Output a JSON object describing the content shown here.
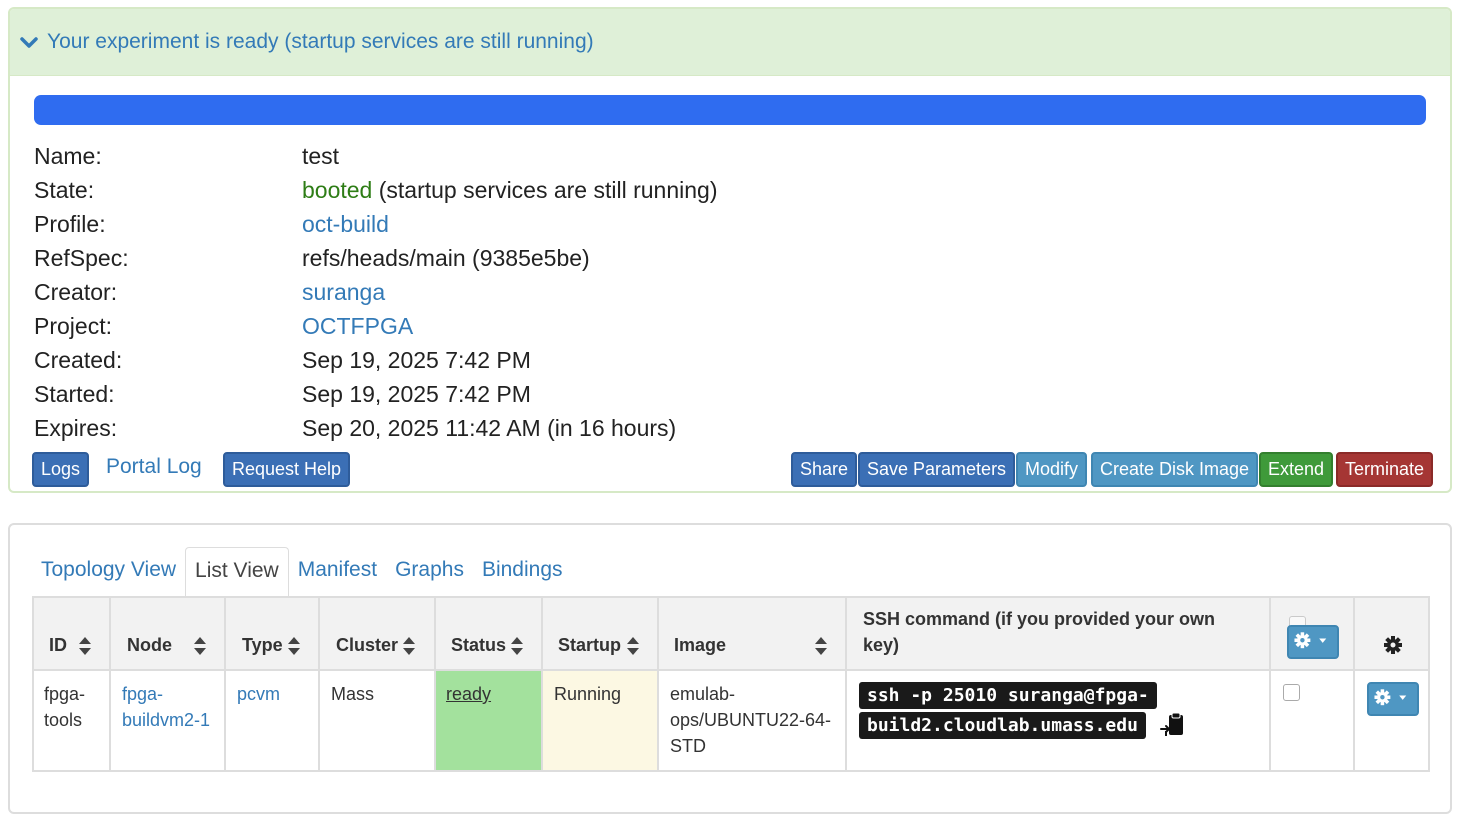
{
  "alert": {
    "title": "Your experiment is ready (startup services are still running)",
    "progress_percent": 100,
    "progress_color": "#2f6cf0"
  },
  "details": {
    "name_label": "Name:",
    "name_value": "test",
    "state_label": "State:",
    "state_word": "booted",
    "state_rest": " (startup services are still running)",
    "profile_label": "Profile:",
    "profile_value": "oct-build",
    "refspec_label": "RefSpec:",
    "refspec_value": "refs/heads/main (9385e5be)",
    "creator_label": "Creator:",
    "creator_value": "suranga",
    "project_label": "Project:",
    "project_value": "OCTFPGA",
    "created_label": "Created:",
    "created_value": "Sep 19, 2025 7:42 PM",
    "started_label": "Started:",
    "started_value": "Sep 19, 2025 7:42 PM",
    "expires_label": "Expires:",
    "expires_value": "Sep 20, 2025 11:42 AM (in 16 hours)"
  },
  "actions": {
    "logs": "Logs",
    "portal_log": "Portal Log",
    "request_help": "Request Help",
    "share": "Share",
    "save_parameters": "Save Parameters",
    "modify": "Modify",
    "create_disk_image": "Create Disk Image",
    "extend": "Extend",
    "terminate": "Terminate"
  },
  "tabs": [
    "Topology View",
    "List View",
    "Manifest",
    "Graphs",
    "Bindings"
  ],
  "active_tab": "List View",
  "table": {
    "headers": {
      "id": "ID",
      "node": "Node",
      "type": "Type",
      "cluster": "Cluster",
      "status": "Status",
      "startup": "Startup",
      "image": "Image",
      "ssh_line1": "SSH command (if you provided your own",
      "ssh_line2": "key)"
    },
    "row": {
      "id_line1": "fpga-",
      "id_line2": "tools",
      "node_line1": "fpga-",
      "node_line2": "buildvm2-1",
      "type": "pcvm",
      "cluster": "Mass",
      "status": "ready",
      "startup": "Running",
      "image_line1": "emulab-",
      "image_line2": "ops/UBUNTU22-64-",
      "image_line3": "STD",
      "ssh_line1": "ssh -p 25010 suranga@fpga-",
      "ssh_line2": "build2.cloudlab.umass.edu"
    }
  },
  "icons": {
    "collapse": "chevron-down-icon",
    "sort": "sort-icon",
    "gear": "gear-icon",
    "clipboard": "clipboard-icon"
  },
  "colors": {
    "ready_cell": "#a3e19d",
    "running_cell": "#fcf8e3",
    "booted_text": "#2e7d16"
  }
}
